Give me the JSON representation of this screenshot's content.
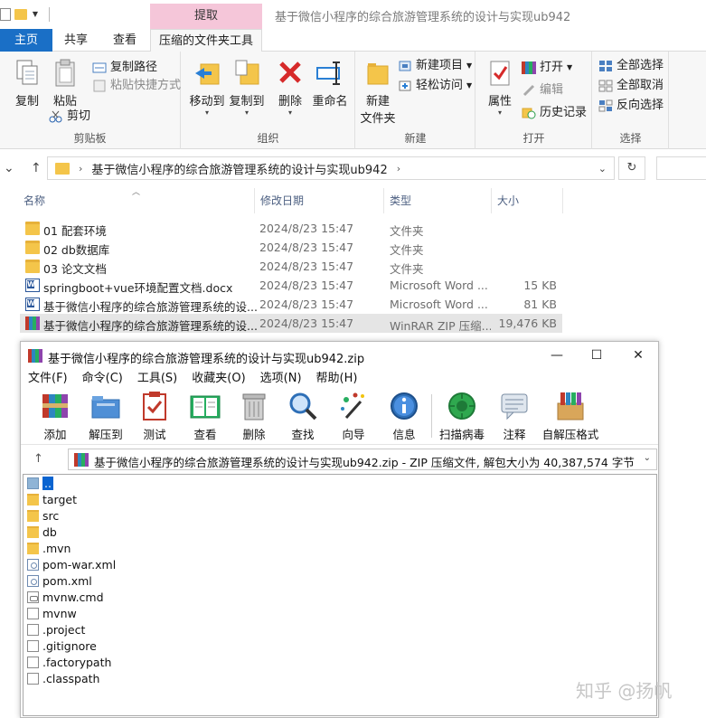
{
  "explorer": {
    "window_title": "基于微信小程序的综合旅游管理系统的设计与实现ub942",
    "context_tab_header": "提取",
    "tabs": [
      "主页",
      "共享",
      "查看",
      "压缩的文件夹工具"
    ],
    "ribbon": {
      "clipboard": {
        "label": "剪贴板",
        "copy": "复制",
        "paste": "粘贴",
        "copy_path": "复制路径",
        "paste_shortcut": "粘贴快捷方式",
        "cut": "剪切"
      },
      "organize": {
        "label": "组织",
        "move_to": "移动到",
        "copy_to": "复制到",
        "delete": "删除",
        "rename": "重命名"
      },
      "new": {
        "label": "新建",
        "new_folder": "新建\n文件夹",
        "new_folder_line1": "新建",
        "new_folder_line2": "文件夹",
        "new_item": "新建项目",
        "easy_access": "轻松访问"
      },
      "open": {
        "label": "打开",
        "properties": "属性",
        "open": "打开",
        "edit": "编辑",
        "history": "历史记录"
      },
      "select": {
        "label": "选择",
        "select_all": "全部选择",
        "select_none": "全部取消",
        "invert": "反向选择"
      }
    },
    "address_path": "基于微信小程序的综合旅游管理系统的设计与实现ub942",
    "columns": {
      "name": "名称",
      "date": "修改日期",
      "type": "类型",
      "size": "大小"
    },
    "files": [
      {
        "icon": "folder-icon",
        "name": "01 配套环境",
        "date": "2024/8/23 15:47",
        "type": "文件夹",
        "size": ""
      },
      {
        "icon": "folder-icon",
        "name": "02 db数据库",
        "date": "2024/8/23 15:47",
        "type": "文件夹",
        "size": ""
      },
      {
        "icon": "folder-icon",
        "name": "03 论文文档",
        "date": "2024/8/23 15:47",
        "type": "文件夹",
        "size": ""
      },
      {
        "icon": "word-doc-icon",
        "name": "springboot+vue环境配置文档.docx",
        "date": "2024/8/23 15:47",
        "type": "Microsoft Word ...",
        "size": "15 KB"
      },
      {
        "icon": "word-doc-icon",
        "name": "基于微信小程序的综合旅游管理系统的设...",
        "date": "2024/8/23 15:47",
        "type": "Microsoft Word ...",
        "size": "81 KB"
      },
      {
        "icon": "rar-archive-icon",
        "name": "基于微信小程序的综合旅游管理系统的设...",
        "date": "2024/8/23 15:47",
        "type": "WinRAR ZIP 压缩...",
        "size": "19,476 KB"
      }
    ]
  },
  "winrar": {
    "title": "基于微信小程序的综合旅游管理系统的设计与实现ub942.zip",
    "window_controls": {
      "minimize": "—",
      "maximize": "☐",
      "close": "✕"
    },
    "menu": [
      "文件(F)",
      "命令(C)",
      "工具(S)",
      "收藏夹(O)",
      "选项(N)",
      "帮助(H)"
    ],
    "toolbar": [
      "添加",
      "解压到",
      "测试",
      "查看",
      "删除",
      "查找",
      "向导",
      "信息",
      "扫描病毒",
      "注释",
      "自解压格式"
    ],
    "address_text": "基于微信小程序的综合旅游管理系统的设计与实现ub942.zip - ZIP 压缩文件, 解包大小为 40,387,574 字节",
    "entries": [
      {
        "icon": "parent-folder-icon",
        "name": ".."
      },
      {
        "icon": "folder-icon",
        "name": "target"
      },
      {
        "icon": "folder-icon",
        "name": "src"
      },
      {
        "icon": "folder-icon",
        "name": "db"
      },
      {
        "icon": "folder-icon",
        "name": ".mvn"
      },
      {
        "icon": "xml-file-icon",
        "name": "pom-war.xml"
      },
      {
        "icon": "xml-file-icon",
        "name": "pom.xml"
      },
      {
        "icon": "cmd-file-icon",
        "name": "mvnw.cmd"
      },
      {
        "icon": "file-icon",
        "name": "mvnw"
      },
      {
        "icon": "file-icon",
        "name": ".project"
      },
      {
        "icon": "file-icon",
        "name": ".gitignore"
      },
      {
        "icon": "file-icon",
        "name": ".factorypath"
      },
      {
        "icon": "file-icon",
        "name": ".classpath"
      }
    ]
  },
  "watermark": "知乎 @扬帆",
  "colors": {
    "accent_blue": "#1a6fc6",
    "context_tab_pink": "#f5c6d9",
    "folder_yellow": "#f4c54a",
    "selection_blue": "#0a64d0",
    "delete_red": "#d62a2a"
  }
}
